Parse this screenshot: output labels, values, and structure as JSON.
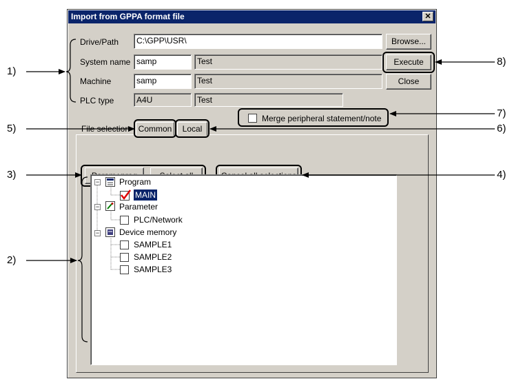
{
  "window": {
    "title": "Import from GPPA format file",
    "close_glyph": "✕"
  },
  "form": {
    "drive_label": "Drive/Path",
    "drive_value": "C:\\GPP\\USR\\",
    "system_label": "System name",
    "system_value": "samp",
    "system_desc": "Test",
    "machine_label": "Machine",
    "machine_value": "samp",
    "machine_desc": "Test",
    "plc_label": "PLC type",
    "plc_value": "A4U",
    "plc_desc": "Test"
  },
  "buttons": {
    "browse": "Browse...",
    "execute": "Execute",
    "close": "Close",
    "param_prog": "Param+prog",
    "select_all": "Select all",
    "cancel_all": "Cancel all selections"
  },
  "merge_label": "Merge peripheral statement/note",
  "tabs": {
    "file_selection": "File selection",
    "common": "Common",
    "local": "Local"
  },
  "tree": {
    "program": "Program",
    "main": "MAIN",
    "parameter": "Parameter",
    "plc_network": "PLC/Network",
    "device_memory": "Device memory",
    "samples": [
      "SAMPLE1",
      "SAMPLE2",
      "SAMPLE3"
    ],
    "main_checked": true
  },
  "callouts": {
    "c1": "1)",
    "c2": "2)",
    "c3": "3)",
    "c4": "4)",
    "c5": "5)",
    "c6": "6)",
    "c7": "7)",
    "c8": "8)"
  }
}
